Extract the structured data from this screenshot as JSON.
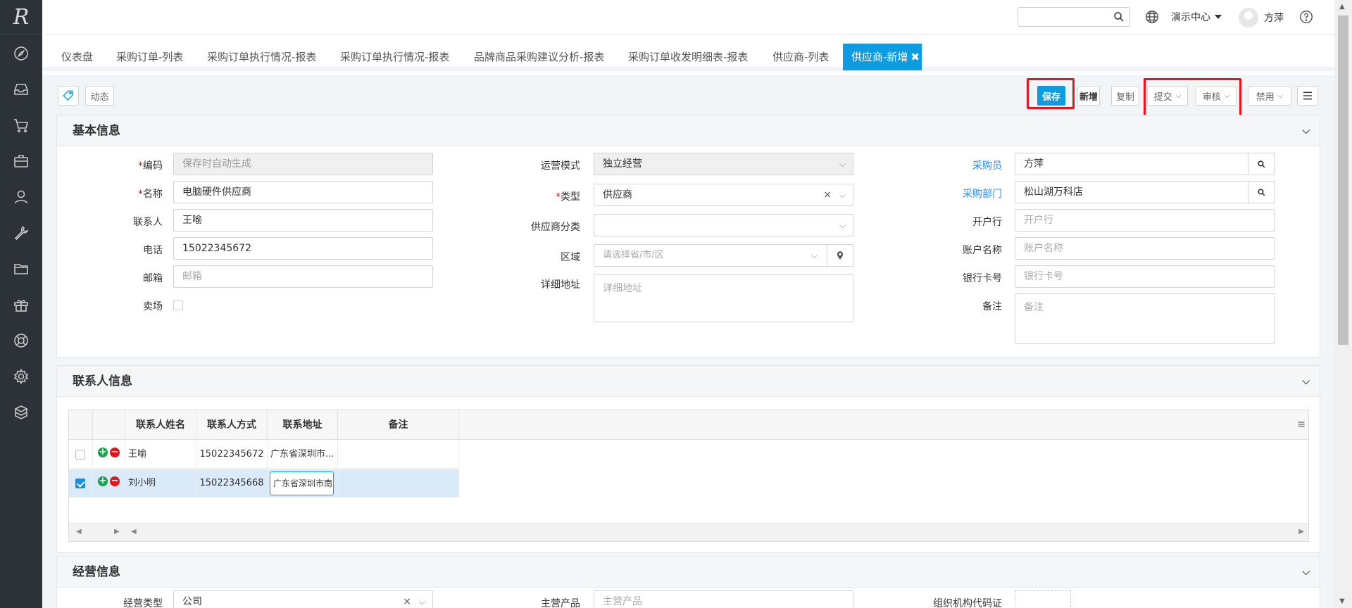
{
  "header": {
    "search_placeholder": "",
    "center_label": "演示中心",
    "user_name": "方萍"
  },
  "tabs": [
    {
      "label": "仪表盘"
    },
    {
      "label": "采购订单-列表"
    },
    {
      "label": "采购订单执行情况-报表"
    },
    {
      "label": "采购订单执行情况-报表"
    },
    {
      "label": "品牌商品采购建议分析-报表"
    },
    {
      "label": "采购订单收发明细表-报表"
    },
    {
      "label": "供应商-列表"
    },
    {
      "label": "供应商-新增",
      "close": "✖"
    }
  ],
  "toolbar": {
    "dynamic_label": "动态",
    "save_label": "保存",
    "new_label": "新增",
    "copy_label": "复制",
    "submit_label": "提交",
    "review_label": "审核",
    "disable_label": "禁用"
  },
  "basic": {
    "title": "基本信息",
    "code_label": "编码",
    "code_placeholder": "保存时自动生成",
    "name_label": "名称",
    "name_value": "电脑硬件供应商",
    "contact_label": "联系人",
    "contact_value": "王喻",
    "phone_label": "电话",
    "phone_value": "15022345672",
    "email_label": "邮箱",
    "email_placeholder": "邮箱",
    "store_label": "卖场",
    "mode_label": "运营模式",
    "mode_value": "独立经营",
    "type_label": "类型",
    "type_value": "供应商",
    "category_label": "供应商分类",
    "category_value": "",
    "region_label": "区域",
    "region_placeholder": "请选择省/市/区",
    "address_label": "详细地址",
    "address_placeholder": "详细地址",
    "buyer_label": "采购员",
    "buyer_value": "方萍",
    "dept_label": "采购部门",
    "dept_value": "松山湖万科店",
    "bank_label": "开户行",
    "bank_placeholder": "开户行",
    "account_label": "账户名称",
    "account_placeholder": "账户名称",
    "card_label": "银行卡号",
    "card_placeholder": "银行卡号",
    "remark_label": "备注",
    "remark_placeholder": "备注"
  },
  "contacts": {
    "title": "联系人信息",
    "columns": [
      "联系人姓名",
      "联系人方式",
      "联系地址",
      "备注"
    ],
    "rows": [
      {
        "name": "王喻",
        "phone": "15022345672",
        "address": "广东省深圳市...",
        "remark": "",
        "checked": false
      },
      {
        "name": "刘小明",
        "phone": "15022345668",
        "address": "广东省深圳市南",
        "remark": "",
        "checked": true
      }
    ]
  },
  "business": {
    "title": "经营信息",
    "biz_type_label": "经营类型",
    "biz_type_value": "公司",
    "main_product_label": "主营产品",
    "main_product_placeholder": "主营产品",
    "org_code_label": "组织机构代码证"
  },
  "colors": {
    "accent": "#0d9ce0",
    "sidebar": "#2d3138",
    "highlight": "#e8141e"
  }
}
